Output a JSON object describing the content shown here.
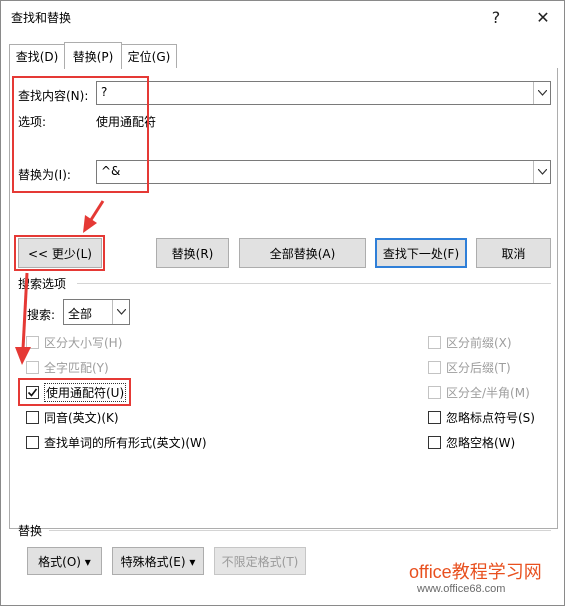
{
  "window": {
    "title": "查找和替换",
    "help_glyph": "?",
    "close_glyph": "✕"
  },
  "tabs": [
    {
      "label": "查找(D)"
    },
    {
      "label": "替换(P)",
      "active": true
    },
    {
      "label": "定位(G)"
    }
  ],
  "find": {
    "label": "查找内容(N):",
    "value": "?",
    "options_label": "选项:",
    "options_value": "使用通配符"
  },
  "replace": {
    "label": "替换为(I):",
    "value": "^&"
  },
  "buttons": {
    "less": "<< 更少(L)",
    "replace": "替换(R)",
    "replace_all": "全部替换(A)",
    "find_next": "查找下一处(F)",
    "cancel": "取消"
  },
  "search_options": {
    "group_label": "搜索选项",
    "search_label": "搜索:",
    "search_value": "全部",
    "left": [
      {
        "label": "区分大小写(H)",
        "checked": false,
        "disabled": true
      },
      {
        "label": "全字匹配(Y)",
        "checked": false,
        "disabled": true
      },
      {
        "label": "使用通配符(U)",
        "checked": true,
        "disabled": false
      },
      {
        "label": "同音(英文)(K)",
        "checked": false,
        "disabled": false
      },
      {
        "label": "查找单词的所有形式(英文)(W)",
        "checked": false,
        "disabled": false
      }
    ],
    "right": [
      {
        "label": "区分前缀(X)",
        "checked": false,
        "disabled": true
      },
      {
        "label": "区分后缀(T)",
        "checked": false,
        "disabled": true
      },
      {
        "label": "区分全/半角(M)",
        "checked": false,
        "disabled": true
      },
      {
        "label": "忽略标点符号(S)",
        "checked": false,
        "disabled": false
      },
      {
        "label": "忽略空格(W)",
        "checked": false,
        "disabled": false
      }
    ]
  },
  "replace_section": {
    "group_label": "替换",
    "format_button": "格式(O) ▾",
    "special_button": "特殊格式(E) ▾",
    "no_format_button": "不限定格式(T)"
  },
  "watermark": {
    "line1": "office教程学习网",
    "line2": "www.office68.com"
  },
  "colors": {
    "highlight": "#e53935",
    "default_button_border": "#2f7fd8"
  }
}
